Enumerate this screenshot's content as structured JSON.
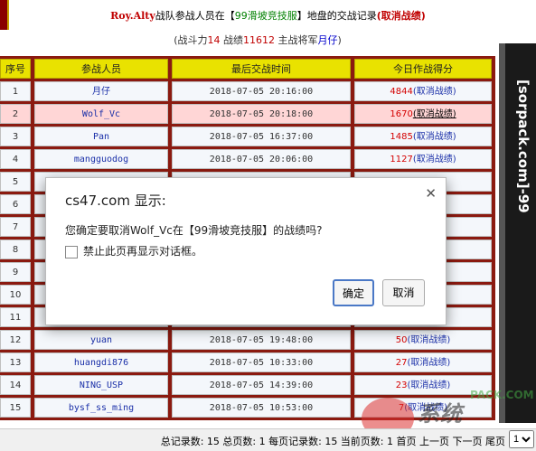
{
  "header": {
    "user": "Roy.Alty",
    "text1": "战队参战人员在【",
    "server": "99滑坡竞技服",
    "text2": "】地盘的交战记录",
    "cancel": "(取消战绩)"
  },
  "subtitle": {
    "p1": "(战斗力",
    "power": "14",
    "p2": " 战绩",
    "score": "11612",
    "p3": " 主战将军",
    "general": "月仔",
    "p4": ")"
  },
  "table": {
    "headers": [
      "序号",
      "参战人员",
      "最后交战时间",
      "今日作战得分"
    ],
    "rows": [
      {
        "no": "1",
        "name": "月仔",
        "time": "2018-07-05 20:16:00",
        "score": "4844",
        "action": "(取消战绩)"
      },
      {
        "no": "2",
        "name": "Wolf_Vc",
        "time": "2018-07-05 20:18:00",
        "score": "1670",
        "action": "(取消战绩)"
      },
      {
        "no": "3",
        "name": "Pan",
        "time": "2018-07-05 16:37:00",
        "score": "1485",
        "action": "(取消战绩)"
      },
      {
        "no": "4",
        "name": "mangguodog",
        "time": "2018-07-05 20:06:00",
        "score": "1127",
        "action": "(取消战绩)"
      },
      {
        "no": "5",
        "name": "",
        "time": "",
        "score": "",
        "action": ""
      },
      {
        "no": "6",
        "name": "",
        "time": "",
        "score": "",
        "action": ""
      },
      {
        "no": "7",
        "name": "",
        "time": "",
        "score": "",
        "action": ""
      },
      {
        "no": "8",
        "name": "",
        "time": "",
        "score": "",
        "action": ""
      },
      {
        "no": "9",
        "name": "",
        "time": "",
        "score": "",
        "action": ""
      },
      {
        "no": "10",
        "name": "",
        "time": "",
        "score": "",
        "action": ""
      },
      {
        "no": "11",
        "name": "",
        "time": "",
        "score": "",
        "action": ""
      },
      {
        "no": "12",
        "name": "yuan",
        "time": "2018-07-05 19:48:00",
        "score": "50",
        "action": "(取消战绩)"
      },
      {
        "no": "13",
        "name": "huangdi876",
        "time": "2018-07-05 10:33:00",
        "score": "27",
        "action": "(取消战绩)"
      },
      {
        "no": "14",
        "name": "NING_USP",
        "time": "2018-07-05 14:39:00",
        "score": "23",
        "action": "(取消战绩)"
      },
      {
        "no": "15",
        "name": "bysf_ss_ming",
        "time": "2018-07-05 10:53:00",
        "score": "7",
        "action": "(取消战绩)"
      }
    ]
  },
  "side_panel": {
    "vertical_text": "[sorpack.com]-99"
  },
  "footer": {
    "text": "总记录数: 15 总页数: 1 每页记录数: 15 当前页数: 1 首页 上一页 下一页 尾页",
    "page_select": "1"
  },
  "watermark": {
    "text": "系统",
    "brand": "PACK.COM"
  },
  "dialog": {
    "title": "cs47.com 显示:",
    "message": "您确定要取消Wolf_Vc在【99滑坡竞技服】的战绩吗?",
    "checkbox_label": "禁止此页再显示对话框。",
    "ok_label": "确定",
    "cancel_label": "取消"
  },
  "colors": {
    "header_yellow": "#e9e200",
    "table_border": "#8b1a10",
    "score_red": "#d40000",
    "link_blue": "#1a2fa8",
    "highlight_row": "#ffd6d6"
  }
}
